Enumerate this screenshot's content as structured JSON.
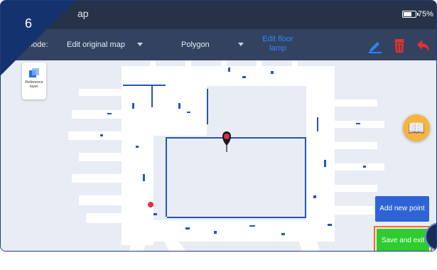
{
  "step_badge": "6",
  "status": {
    "title": "ap",
    "battery": "75%",
    "battery_level": 0.75
  },
  "toolbar": {
    "mode_label": "mode:",
    "mode_value": "Edit original map",
    "shape_value": "Polygon",
    "floor_link": "Edit floor lamp"
  },
  "reference_layer": {
    "label": "Reference layer"
  },
  "buttons": {
    "add_new_point": "Add new point",
    "save_and_exit": "Save and exit"
  },
  "icons": {
    "edit": "pencil-icon",
    "delete": "trash-icon",
    "undo": "undo-arrow-icon",
    "book": "open-book-icon",
    "location": "map-pin-icon"
  },
  "colors": {
    "statusbar": "#263247",
    "toolbar": "#33435f",
    "accent": "#2f82ff",
    "delete": "#e53030",
    "add_button": "#2e63d6",
    "save_button": "#2ecc2e",
    "highlight": "#ff6a1a",
    "book": "#f5b53c"
  }
}
